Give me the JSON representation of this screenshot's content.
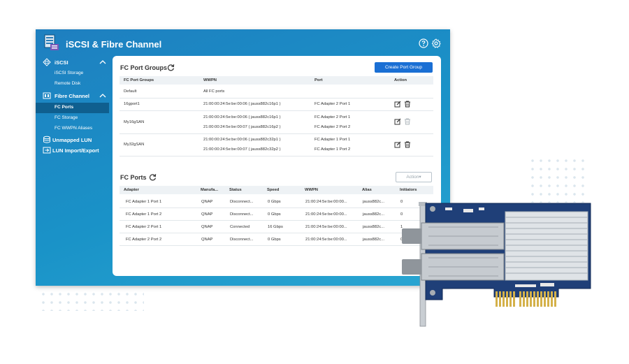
{
  "app": {
    "title": "iSCSI & Fibre Channel"
  },
  "header": {
    "help_icon": "help-icon",
    "settings_icon": "gear-icon"
  },
  "sidebar": {
    "iscsi": {
      "label": "iSCSI",
      "children": [
        "iSCSI Storage",
        "Remote Disk"
      ]
    },
    "fibre": {
      "label": "Fibre Channel",
      "children": [
        "FC Ports",
        "FC Storage",
        "FC WWPN Aliases"
      ]
    },
    "unmapped": {
      "label": "Unmapped LUN"
    },
    "import_export": {
      "label": "LUN Import/Export"
    },
    "active": "FC Ports"
  },
  "port_groups": {
    "title": "FC Port Groups",
    "create_button": "Create Port Group",
    "columns": [
      "FC Port Groups",
      "WWPN",
      "Port",
      "Action"
    ],
    "rows": [
      {
        "name": "Default",
        "wwpn": [
          "All FC ports"
        ],
        "port": []
      },
      {
        "name": "16gport1",
        "wwpn": [
          "21:00:00:24:5e:be:00:06 ( jauss882c16p1 )"
        ],
        "port": [
          "FC Adapter 2 Port 1"
        ]
      },
      {
        "name": "My16gSAN",
        "wwpn": [
          "21:00:00:24:5e:be:00:06 ( jauss882c16p1 )",
          "21:00:00:24:5e:be:00:07 ( jauss882c16p2 )"
        ],
        "port": [
          "FC Adapter 2 Port 1",
          "FC Adapter 2 Port 2"
        ]
      },
      {
        "name": "My32gSAN",
        "wwpn": [
          "21:00:00:24:5e:be:00:06 ( jauss882c32p1 )",
          "21:00:00:24:5e:be:00:07 ( jauss882c32p2 )"
        ],
        "port": [
          "FC Adapter 1 Port 1",
          "FC Adapter 1 Port 2"
        ]
      }
    ]
  },
  "fc_ports": {
    "title": "FC Ports",
    "action_button": "Action▾",
    "columns": [
      "Adapter",
      "Manufa...",
      "Status",
      "Speed",
      "WWPN",
      "Alias",
      "Initiators"
    ],
    "rows": [
      {
        "adapter": "FC Adapter 1 Port 1",
        "manufacturer": "QNAP",
        "status": "Disconnect...",
        "speed": "0 Gbps",
        "wwpn": "21:00:24:5e:be:00:00...",
        "alias": "jauss882c...",
        "initiators": "0"
      },
      {
        "adapter": "FC Adapter 1 Port 2",
        "manufacturer": "QNAP",
        "status": "Disconnect...",
        "speed": "0 Gbps",
        "wwpn": "21:00:24:5e:be:00:00...",
        "alias": "jauss882c...",
        "initiators": "0"
      },
      {
        "adapter": "FC Adapter 2 Port 1",
        "manufacturer": "QNAP",
        "status": "Connected",
        "speed": "16 Gbps",
        "wwpn": "21:00:24:5e:be:00:00...",
        "alias": "jauss882c...",
        "initiators": "1"
      },
      {
        "adapter": "FC Adapter 2 Port 2",
        "manufacturer": "QNAP",
        "status": "Disconnect...",
        "speed": "0 Gbps",
        "wwpn": "21:00:24:5e:be:00:00...",
        "alias": "jauss882c...",
        "initiators": "0"
      }
    ]
  },
  "colors": {
    "accent": "#1a6fd4",
    "window": "#1a93c8",
    "sidebar_active": "#0f5f8f"
  }
}
